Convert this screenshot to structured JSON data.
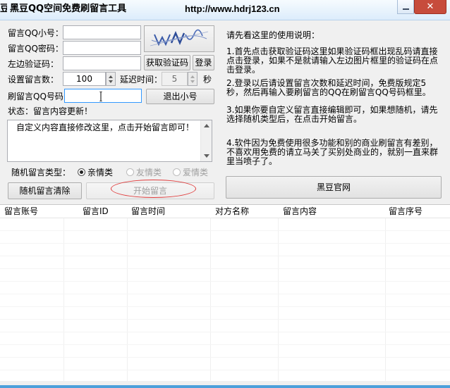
{
  "window": {
    "icon_glyph": "豆",
    "title": "黑豆QQ空间免费刷留言工具",
    "url": "http://www.hdrj123.cn",
    "close_glyph": "✕"
  },
  "form": {
    "qq_label": "留言QQ小号：",
    "qq_value": "",
    "password_label": "留言QQ密码：",
    "password_value": "",
    "captcha_label": "左边验证码：",
    "captcha_value": "",
    "get_captcha_button": "获取验证码",
    "login_button": "登录",
    "count_label": "设置留言数：",
    "count_value": "100",
    "delay_label": "延迟时间：",
    "delay_value": "5",
    "delay_unit": "秒",
    "target_label": "刷留言QQ号码：",
    "target_value": "",
    "logout_button": "退出小号",
    "status_text": "状态：留言内容更新！",
    "message_content": "自定义内容直接修改这里，点击开始留言即可！",
    "random_type_label": "随机留言类型：",
    "radio_options": [
      {
        "label": "亲情类",
        "checked": true,
        "disabled": false
      },
      {
        "label": "友情类",
        "checked": false,
        "disabled": true
      },
      {
        "label": "爱情类",
        "checked": false,
        "disabled": true
      }
    ],
    "clear_random_button": "随机留言清除",
    "start_button": "开始留言"
  },
  "instructions": {
    "heading": "请先看这里的使用说明：",
    "steps": [
      "1.首先点击获取验证码这里如果验证码框出现乱码请直接点击登录，如果不是就请输入左边图片框里的验证码在点击登录。",
      "2.登录以后请设置留言次数和延迟时间，免费版规定5秒，然后再输入要刷留言的QQ在刷留言QQ号码框里。",
      "3.如果你要自定义留言直接编辑即可，如果想随机，请先选择随机类型后，在点击开始留言。",
      "4.软件因为免费使用很多功能和别的商业刷留言有差别，不喜欢用免费的请立马关了买别处商业的，就别一直来群里当喷子了。"
    ],
    "official_site_button": "黑豆官网"
  },
  "table": {
    "columns": [
      "留言账号",
      "留言ID",
      "留言时间",
      "对方名称",
      "留言内容",
      "留言序号"
    ],
    "rows": []
  },
  "colors": {
    "accent": "#3399ff",
    "close_button": "#c74c3c",
    "highlight_ellipse": "#e03c3c",
    "taskbar": "#4da0db"
  }
}
